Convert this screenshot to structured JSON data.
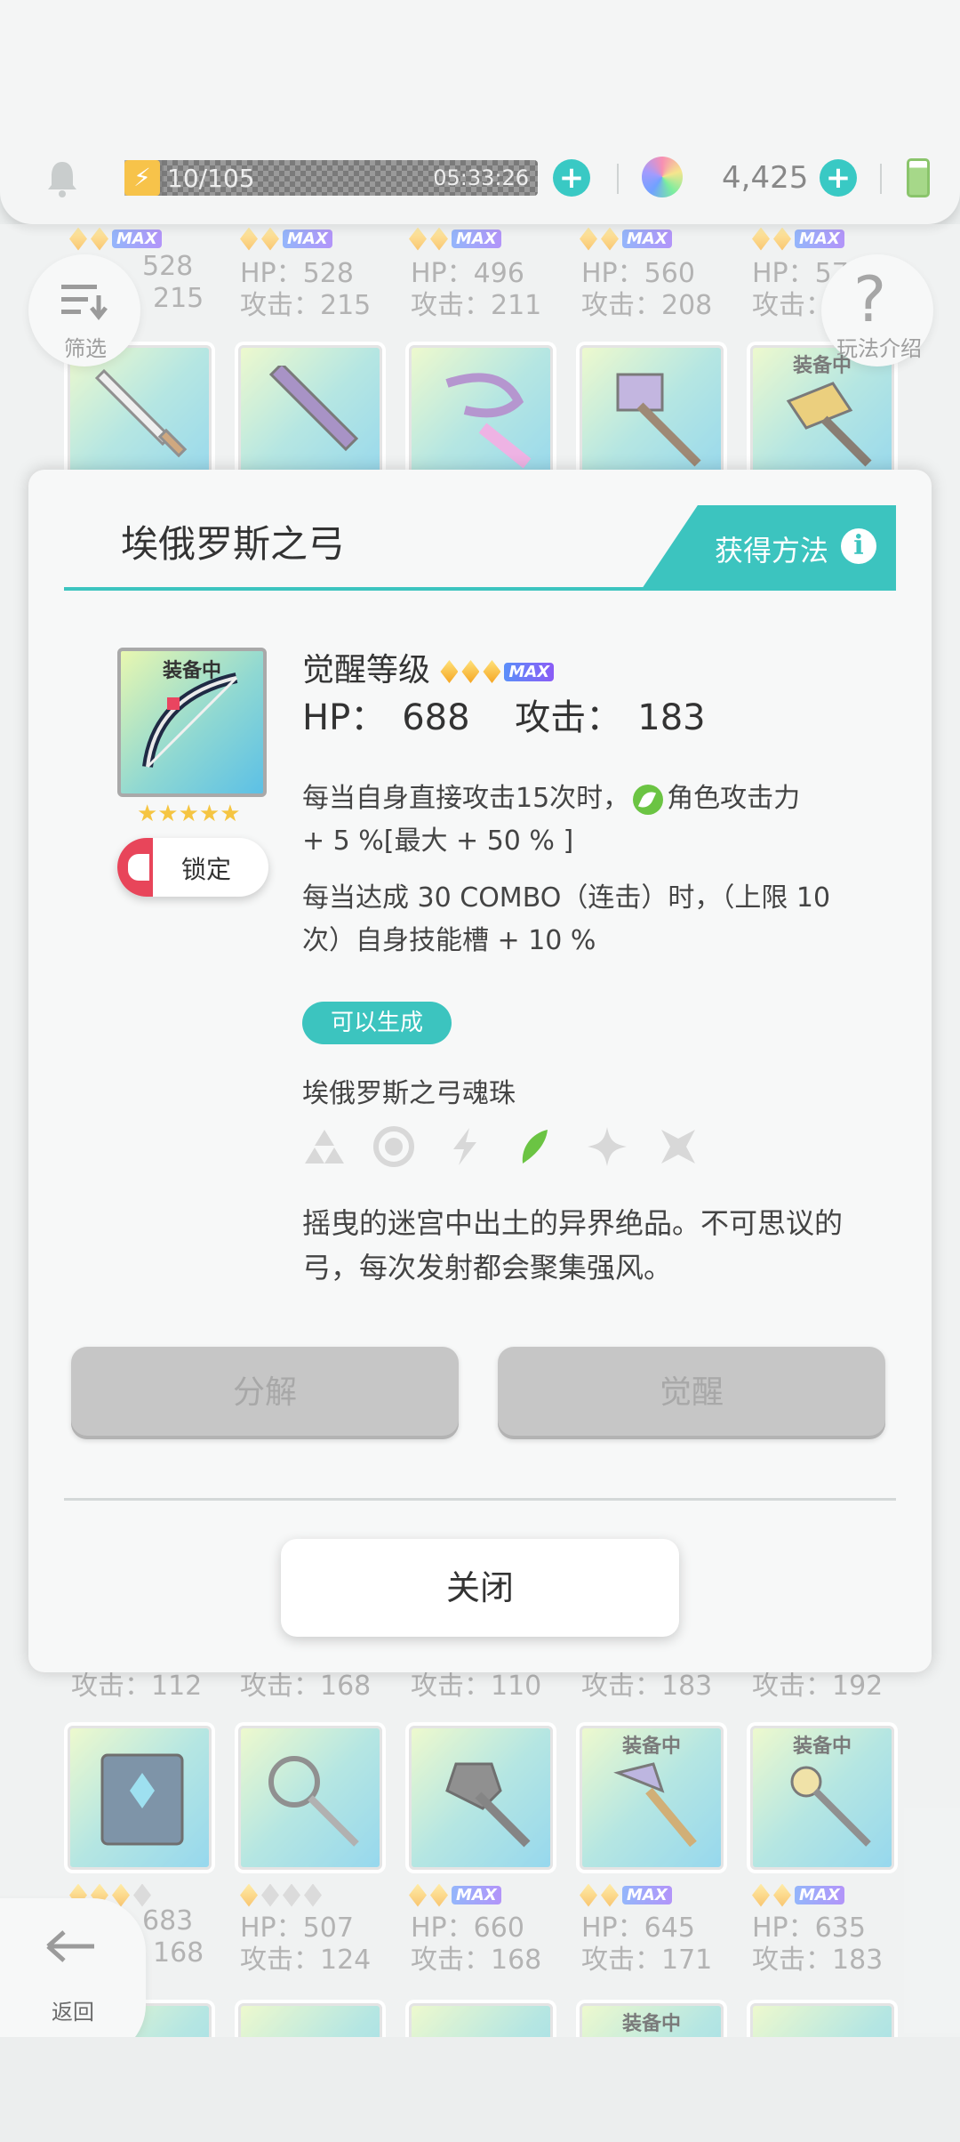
{
  "topbar": {
    "stamina": "10/105",
    "stamina_progress": 0.095,
    "timer": "05:33:26",
    "gem_count": "4,425",
    "icons": [
      "bell-icon",
      "lightning-icon",
      "plus-icon",
      "gem-icon",
      "battery-icon"
    ]
  },
  "background_grid": {
    "row1": [
      {
        "hp": "528",
        "attack": "215"
      },
      {
        "hp": "HP：528",
        "attack": "攻击：215"
      },
      {
        "hp": "HP：496",
        "attack": "攻击：211"
      },
      {
        "hp": "HP：560",
        "attack": "攻击：208"
      },
      {
        "hp": "HP：576",
        "attack": "攻击："
      }
    ],
    "row2_attack": [
      "攻击：112",
      "攻击：168",
      "攻击：110",
      "攻击：183",
      "攻击：192"
    ],
    "row3": [
      {
        "hp": "683",
        "attack": "168",
        "equipped": ""
      },
      {
        "hp": "HP：507",
        "attack": "攻击：124",
        "equipped": ""
      },
      {
        "hp": "HP：660",
        "attack": "攻击：168",
        "equipped": ""
      },
      {
        "hp": "HP：645",
        "attack": "攻击：171",
        "equipped": "装备中"
      },
      {
        "hp": "HP：635",
        "attack": "攻击：183",
        "equipped": "装备中"
      }
    ],
    "row4_equipped": "装备中",
    "row_top_equipped": "装备中"
  },
  "float_buttons": {
    "filter_label": "筛选",
    "guide_label": "玩法介绍",
    "back_label": "返回"
  },
  "modal": {
    "title": "埃俄罗斯之弓",
    "obtain_label": "获得方法",
    "equipped_tag": "装备中",
    "stars": "★★★★★",
    "lock_label": "锁定",
    "awaken_label": "觉醒等级",
    "max_tag": "MAX",
    "hp_label": "HP：",
    "hp_value": "688",
    "attack_label": "攻击：",
    "attack_value": "183",
    "skill1_a": "每当自身直接攻击15次时，",
    "skill1_b": "角色攻击力",
    "skill1_c": "+ 5 %[最大 + 50 % ]",
    "skill2": "每当达成 30 COMBO（连击）时，（上限 10 次）自身技能槽 + 10 %",
    "generate_badge": "可以生成",
    "soul_name": "埃俄罗斯之弓魂珠",
    "flavor": "摇曳的迷宫中出土的异界绝品。不可思议的弓，每次发射都会聚集强风。",
    "decompose_label": "分解",
    "awaken_button_label": "觉醒",
    "close_label": "关闭",
    "element_icons": [
      "earth-element-icon",
      "ring-element-icon",
      "lightning-element-icon",
      "wind-element-icon",
      "light-element-icon",
      "dark-element-icon"
    ],
    "colors": {
      "accent": "#3cc4bf",
      "lock": "#e8455a",
      "wind": "#6bc443"
    }
  }
}
